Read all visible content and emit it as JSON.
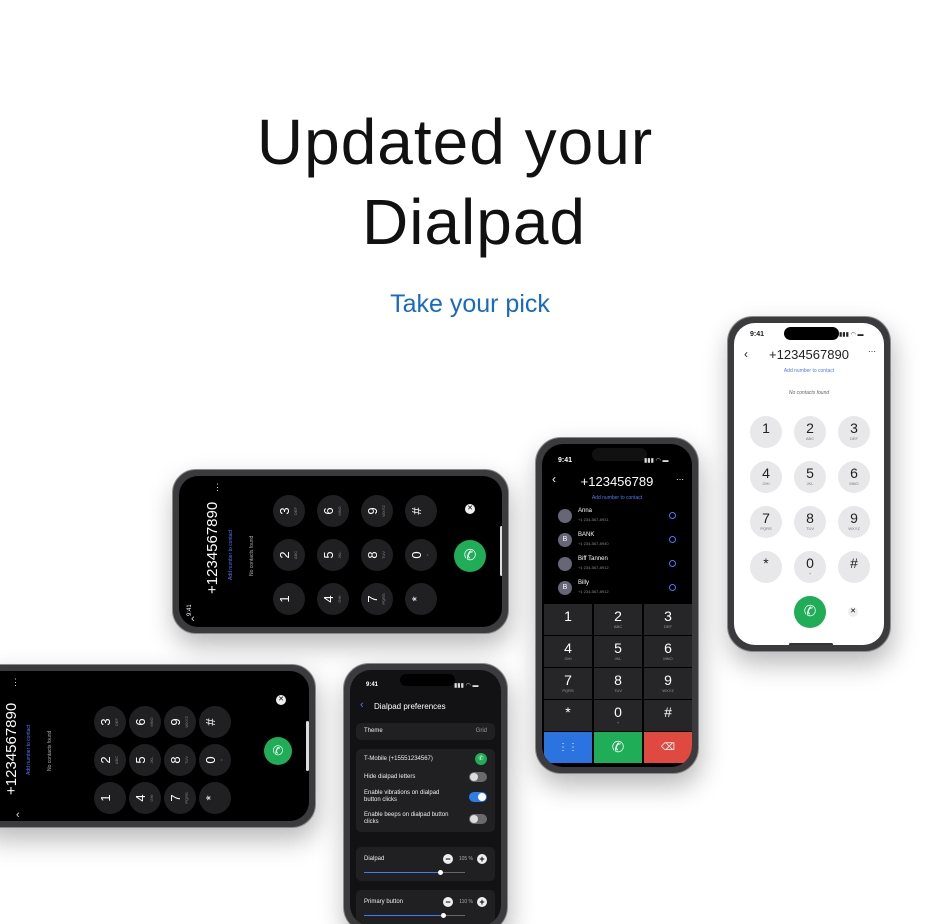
{
  "headline": {
    "line1": "Updated your",
    "line2": "Dialpad",
    "subtitle": "Take your pick"
  },
  "status": {
    "time": "9:41"
  },
  "dialer": {
    "number": "+1234567890",
    "add_contact": "Add number to contact",
    "no_contacts": "No contacts found",
    "keys": [
      {
        "digit": "1",
        "letters": ""
      },
      {
        "digit": "2",
        "letters": "ABC"
      },
      {
        "digit": "3",
        "letters": "DEF"
      },
      {
        "digit": "4",
        "letters": "GHI"
      },
      {
        "digit": "5",
        "letters": "JKL"
      },
      {
        "digit": "6",
        "letters": "MNO"
      },
      {
        "digit": "7",
        "letters": "PQRS"
      },
      {
        "digit": "8",
        "letters": "TUV"
      },
      {
        "digit": "9",
        "letters": "WXYZ"
      },
      {
        "digit": "*",
        "letters": ""
      },
      {
        "digit": "0",
        "letters": "+"
      },
      {
        "digit": "#",
        "letters": ""
      }
    ]
  },
  "dialer_alt": {
    "number": "+123456789",
    "add_contact": "Add number to contact"
  },
  "contacts": [
    {
      "name": "Anna",
      "phone": "+1 234-567-8931",
      "initial": ""
    },
    {
      "name": "BANK",
      "phone": "+1 234-567-8940",
      "initial": "B"
    },
    {
      "name": "Biff Tannen",
      "phone": "+1 234-567-8912",
      "initial": ""
    },
    {
      "name": "Billy",
      "phone": "+1 234-567-8912",
      "initial": "B"
    }
  ],
  "prefs": {
    "title": "Dialpad preferences",
    "theme_label": "Theme",
    "theme_value": "Grid",
    "sim": "T-Mobile (+15551234567)",
    "opt1": "Hide dialpad letters",
    "opt2": "Enable vibrations on dialpad button clicks",
    "opt3": "Enable beeps on dialpad button clicks",
    "dialpad_label": "Dialpad",
    "dialpad_value": "105 %",
    "primary_label": "Primary button",
    "primary_value": "110 %"
  },
  "colors": {
    "accent": "#1769c8",
    "call": "#1fae57",
    "dialpad_btn": "#2b73e0",
    "delete": "#e0493f"
  }
}
